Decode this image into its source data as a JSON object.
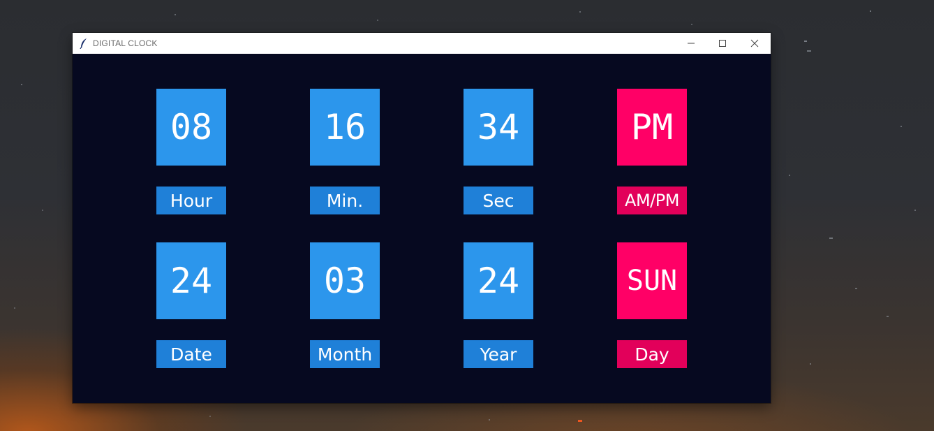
{
  "window": {
    "title": "DIGITAL CLOCK"
  },
  "titlebar_controls": {
    "minimize_icon": "minimize-icon",
    "maximize_icon": "maximize-icon",
    "close_icon": "close-icon"
  },
  "clock": {
    "hour": {
      "value": "08",
      "label": "Hour"
    },
    "minute": {
      "value": "16",
      "label": "Min."
    },
    "second": {
      "value": "34",
      "label": "Sec"
    },
    "ampm": {
      "value": "PM",
      "label": "AM/PM"
    }
  },
  "calendar": {
    "date": {
      "value": "24",
      "label": "Date"
    },
    "month": {
      "value": "03",
      "label": "Month"
    },
    "year": {
      "value": "24",
      "label": "Year"
    },
    "day": {
      "value": "SUN",
      "label": "Day"
    }
  },
  "colors": {
    "window_background": "#060920",
    "value_tile_blue": "#2c96ec",
    "label_blue": "#1f80d8",
    "value_tile_pink": "#ff0066",
    "label_pink": "#e2005a",
    "text": "#ffffff"
  }
}
